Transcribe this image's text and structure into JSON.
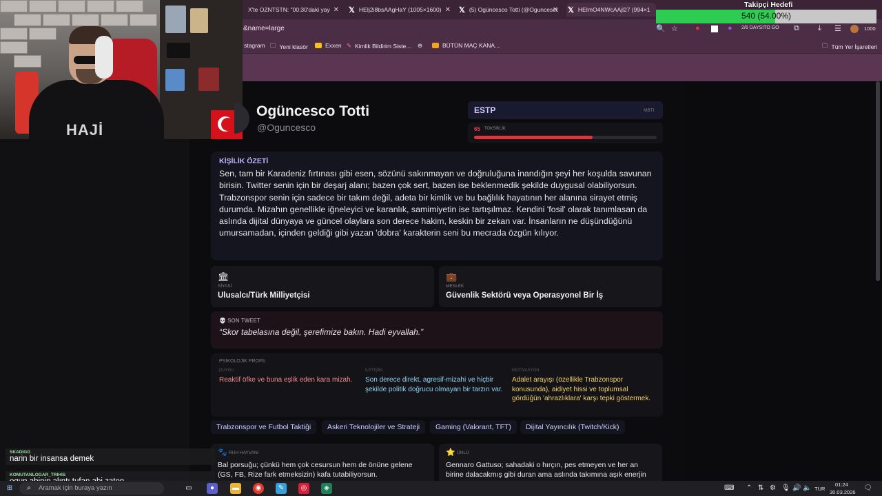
{
  "browser": {
    "tabs": [
      {
        "label": "X'te OZNTSTN: \"00:30'daki yay",
        "active": false
      },
      {
        "label": "HEIj2i8bsAAgHaY (1005×1600)",
        "active": false
      },
      {
        "label": "(5) Ogüncesco Totti (@Oguncesco",
        "active": false
      },
      {
        "label": "HEImO4NWcAAjl27 (994×1",
        "active": true
      }
    ],
    "url": "&name=large",
    "extension_badge": "2/6",
    "extension_label": "DAYSITO GO",
    "extension_count": "1000",
    "bookmarks": [
      "stagram",
      "Yeni klasör",
      "Exxen",
      "Kimlik Bildirim Siste...",
      "BÜTÜN MAÇ KANA..."
    ],
    "all_bookmarks": "Tüm Yer İşaretleri"
  },
  "follower_goal": {
    "title": "Takipçi Hedefi",
    "text": "540 (54.00%)",
    "percent": 54.0,
    "color": "#2ecc52"
  },
  "webcam": {
    "hoodie_text": "HAJİ"
  },
  "profile": {
    "name": "Ogüncesco Totti",
    "handle": "@Oguncesco",
    "mbti_type": "ESTP",
    "mbti_label": "MBTI",
    "toxicity_value": "65",
    "toxicity_label": "TOKSİKLİK",
    "toxicity_percent": 65
  },
  "summary": {
    "heading": "KİŞİLİK ÖZETİ",
    "text": "Sen, tam bir Karadeniz fırtınası gibi esen, sözünü sakınmayan ve doğruluğuna inandığın şeyi her koşulda savunan birisin. Twitter senin için bir deşarj alanı; bazen çok sert, bazen ise beklenmedik şekilde duygusal olabiliyorsun. Trabzonspor senin için sadece bir takım değil, adeta bir kimlik ve bu bağlılık hayatının her alanına sirayet etmiş durumda. Mizahın genellikle iğneleyici ve karanlık, samimiyetin ise tartışılmaz. Kendini 'fosil' olarak tanımlasan da aslında dijital dünyaya ve güncel olaylara son derece hakim, keskin bir zekan var. İnsanların ne düşündüğünü umursamadan, içinden geldiği gibi yazan 'dobra' karakterin seni bu mecrada özgün kılıyor."
  },
  "info": {
    "politics_label": "SİYASİ",
    "politics_value": "Ulusalcı/Türk Milliyetçisi",
    "job_label": "MESLEK",
    "job_value": "Güvenlik Sektörü veya Operasyonel Bir İş"
  },
  "tweet": {
    "label": "SON TWEET",
    "text": "“Skor tabelasına değil, şerefimize bakın. Hadi eyvallah.”"
  },
  "psychology": {
    "title": "PSİKOLOJİK PROFİL",
    "emotion_label": "DUYGU",
    "emotion_text": "Reaktif öfke ve buna eşlik eden kara mizah.",
    "communication_label": "İLETİŞİM",
    "communication_text": "Son derece direkt, agresif-mizahi ve hiçbir şekilde politik doğrucu olmayan bir tarzın var.",
    "motivation_label": "MOTİVASYON",
    "motivation_text": "Adalet arayışı (özellikle Trabzonspor konusunda), aidiyet hissi ve toplumsal gördüğün 'ahrazlıklara' karşı tepki göstermek.",
    "colors": {
      "emotion": "#f08a8a",
      "communication": "#8fd3f5",
      "motivation": "#f3cf6b"
    }
  },
  "tags": [
    "Trabzonspor ve Futbol Taktiği",
    "Askeri Teknolojiler ve Strateji",
    "Gaming (Valorant, TFT)",
    "Dijital Yayıncılık (Twitch/Kick)"
  ],
  "animal": {
    "label": "RUH HAYVANI",
    "text": "Bal porsuğu; çünkü hem çok cesursun hem de önüne gelene (GS, FB, Rize fark etmeksizin) kafa tutabiliyorsun."
  },
  "celebrity": {
    "label": "ÜNLÜ",
    "text": "Gennaro Gattuso; sahadaki o hırçın, pes etmeyen ve her an birine dalacakmış gibi duran ama aslında takımına aşık enerjin"
  },
  "chat": [
    {
      "user": "SKADIGG",
      "message": "narin bir insansa demek"
    },
    {
      "user": "KOMUTANLOGAR_TRIHIS",
      "message": "ogun abinin alıntı tufan abi zaten"
    }
  ],
  "taskbar": {
    "search_placeholder": "Aramak için buraya yazın",
    "lang": "TUR",
    "time": "01:24",
    "date": "30.03.2026"
  }
}
